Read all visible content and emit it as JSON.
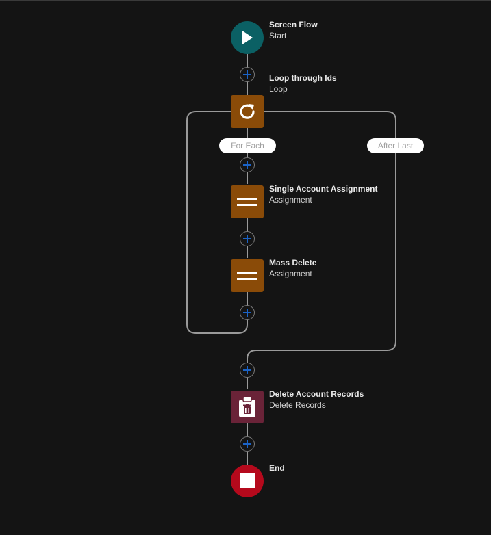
{
  "flow": {
    "nodes": {
      "start": {
        "title": "Screen Flow",
        "subtitle": "Start",
        "icon": "play-icon",
        "color": "#0b6064"
      },
      "loop": {
        "title": "Loop through Ids",
        "subtitle": "Loop",
        "icon": "refresh-icon",
        "color": "#8a4b08"
      },
      "assign1": {
        "title": "Single Account Assignment",
        "subtitle": "Assignment",
        "icon": "equals-icon",
        "color": "#8a4b08"
      },
      "assign2": {
        "title": "Mass Delete",
        "subtitle": "Assignment",
        "icon": "equals-icon",
        "color": "#8a4b08"
      },
      "delete": {
        "title": "Delete Account Records",
        "subtitle": "Delete Records",
        "icon": "clipboard-delete-icon",
        "color": "#6a2338"
      },
      "end": {
        "title": "End",
        "icon": "stop-icon",
        "color": "#b5091c"
      }
    },
    "branches": {
      "for_each": "For Each",
      "after_last": "After Last"
    },
    "colors": {
      "connector": "#9a9a9a",
      "add_icon": "#1b63c6",
      "background": "#141414"
    }
  }
}
